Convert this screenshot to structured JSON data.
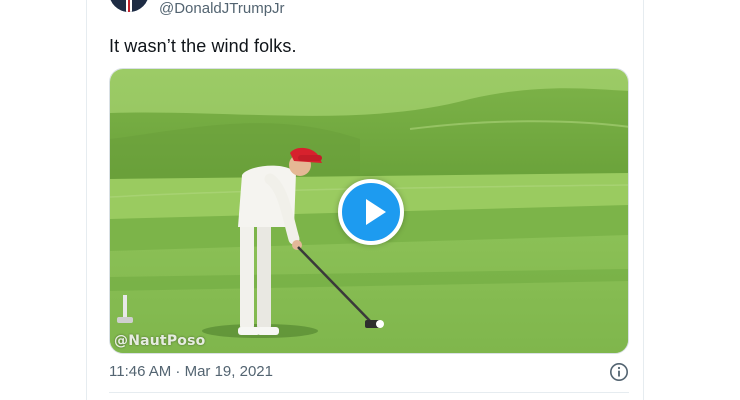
{
  "tweet": {
    "handle": "@DonaldJTrumpJr",
    "text": "It wasn’t the wind folks.",
    "timestamp": "11:46 AM · Mar 19, 2021"
  },
  "media": {
    "type": "video",
    "watermark": "@NautPoso",
    "play_icon": "play-icon"
  },
  "colors": {
    "accent": "#1d9bf0",
    "muted_text": "#536471",
    "text": "#0f1419",
    "grass_light": "#8fc25a",
    "grass_dark": "#6ea43c"
  },
  "icons": {
    "info": "info-icon"
  }
}
